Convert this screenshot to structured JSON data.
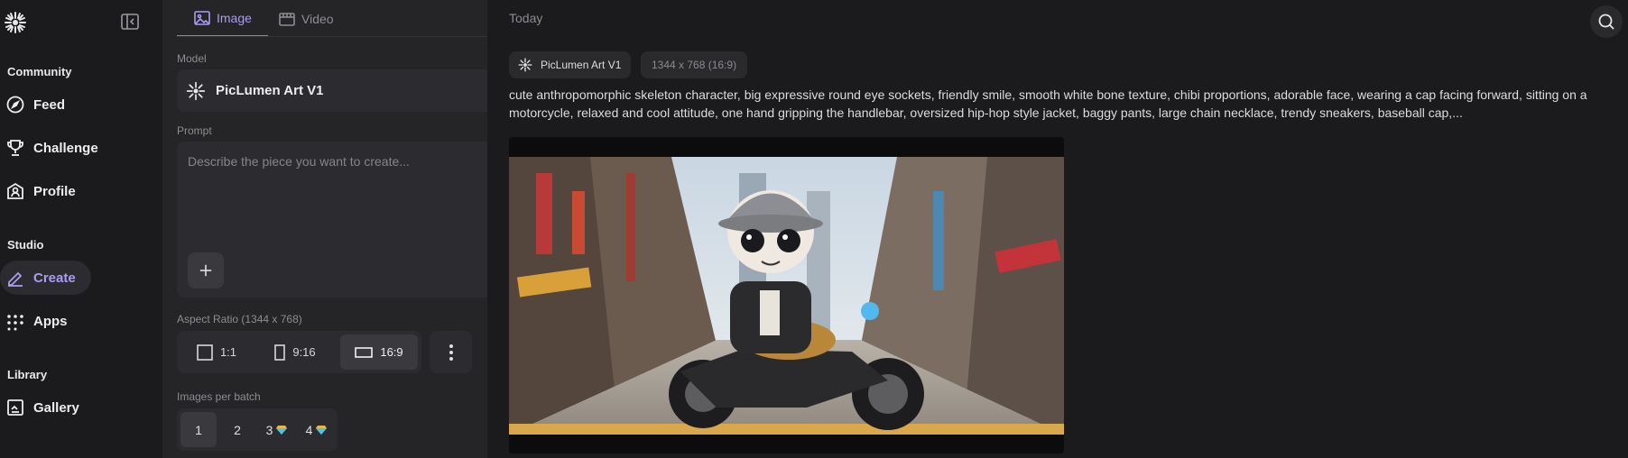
{
  "sidebar": {
    "sections": {
      "community": "Community",
      "studio": "Studio",
      "library": "Library"
    },
    "items": {
      "feed": "Feed",
      "challenge": "Challenge",
      "profile": "Profile",
      "create": "Create",
      "apps": "Apps",
      "gallery": "Gallery"
    },
    "active_item": "Create",
    "accent_color": "#a99cf2"
  },
  "panel": {
    "tabs": [
      {
        "label": "Image",
        "icon": "image-icon",
        "active": true
      },
      {
        "label": "Video",
        "icon": "video-icon",
        "active": false
      }
    ],
    "model": {
      "label": "Model",
      "name": "PicLumen Art V1"
    },
    "prompt": {
      "label": "Prompt",
      "placeholder": "Describe the piece you want to create..."
    },
    "aspect_ratio": {
      "label": "Aspect Ratio (1344 x 768)",
      "options": [
        "1:1",
        "9:16",
        "16:9"
      ],
      "selected": "16:9"
    },
    "batch": {
      "label": "Images per batch",
      "options": [
        "1",
        "2",
        "3",
        "4"
      ],
      "selected": "1"
    }
  },
  "main": {
    "date_heading": "Today",
    "result": {
      "model_chip": "PicLumen Art V1",
      "size_chip": "1344 x 768 (16:9)",
      "prompt": "cute anthropomorphic skeleton character, big expressive round eye sockets, friendly smile, smooth white bone texture, chibi proportions, adorable face, wearing a cap facing forward, sitting on a motorcycle, relaxed and cool attitude, one hand gripping the handlebar, oversized hip-hop style jacket, baggy pants, large chain necklace, trendy sneakers, baseball cap,..."
    }
  }
}
